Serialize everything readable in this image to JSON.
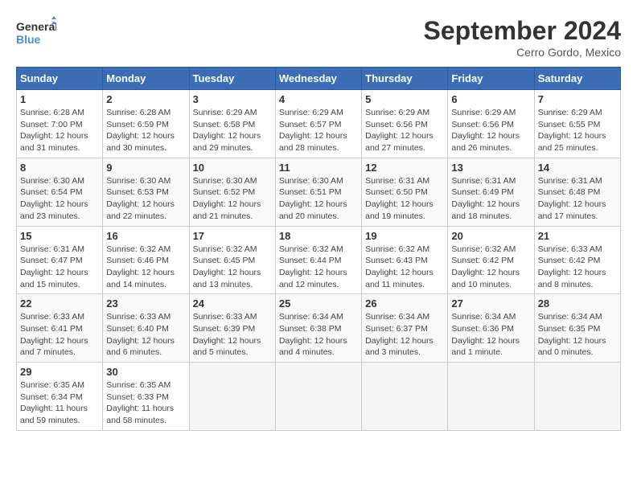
{
  "header": {
    "logo_line1": "General",
    "logo_line2": "Blue",
    "title": "September 2024",
    "subtitle": "Cerro Gordo, Mexico"
  },
  "weekdays": [
    "Sunday",
    "Monday",
    "Tuesday",
    "Wednesday",
    "Thursday",
    "Friday",
    "Saturday"
  ],
  "weeks": [
    [
      {
        "day": "1",
        "sunrise": "6:28 AM",
        "sunset": "7:00 PM",
        "daylight": "12 hours and 31 minutes."
      },
      {
        "day": "2",
        "sunrise": "6:28 AM",
        "sunset": "6:59 PM",
        "daylight": "12 hours and 30 minutes."
      },
      {
        "day": "3",
        "sunrise": "6:29 AM",
        "sunset": "6:58 PM",
        "daylight": "12 hours and 29 minutes."
      },
      {
        "day": "4",
        "sunrise": "6:29 AM",
        "sunset": "6:57 PM",
        "daylight": "12 hours and 28 minutes."
      },
      {
        "day": "5",
        "sunrise": "6:29 AM",
        "sunset": "6:56 PM",
        "daylight": "12 hours and 27 minutes."
      },
      {
        "day": "6",
        "sunrise": "6:29 AM",
        "sunset": "6:56 PM",
        "daylight": "12 hours and 26 minutes."
      },
      {
        "day": "7",
        "sunrise": "6:29 AM",
        "sunset": "6:55 PM",
        "daylight": "12 hours and 25 minutes."
      }
    ],
    [
      {
        "day": "8",
        "sunrise": "6:30 AM",
        "sunset": "6:54 PM",
        "daylight": "12 hours and 23 minutes."
      },
      {
        "day": "9",
        "sunrise": "6:30 AM",
        "sunset": "6:53 PM",
        "daylight": "12 hours and 22 minutes."
      },
      {
        "day": "10",
        "sunrise": "6:30 AM",
        "sunset": "6:52 PM",
        "daylight": "12 hours and 21 minutes."
      },
      {
        "day": "11",
        "sunrise": "6:30 AM",
        "sunset": "6:51 PM",
        "daylight": "12 hours and 20 minutes."
      },
      {
        "day": "12",
        "sunrise": "6:31 AM",
        "sunset": "6:50 PM",
        "daylight": "12 hours and 19 minutes."
      },
      {
        "day": "13",
        "sunrise": "6:31 AM",
        "sunset": "6:49 PM",
        "daylight": "12 hours and 18 minutes."
      },
      {
        "day": "14",
        "sunrise": "6:31 AM",
        "sunset": "6:48 PM",
        "daylight": "12 hours and 17 minutes."
      }
    ],
    [
      {
        "day": "15",
        "sunrise": "6:31 AM",
        "sunset": "6:47 PM",
        "daylight": "12 hours and 15 minutes."
      },
      {
        "day": "16",
        "sunrise": "6:32 AM",
        "sunset": "6:46 PM",
        "daylight": "12 hours and 14 minutes."
      },
      {
        "day": "17",
        "sunrise": "6:32 AM",
        "sunset": "6:45 PM",
        "daylight": "12 hours and 13 minutes."
      },
      {
        "day": "18",
        "sunrise": "6:32 AM",
        "sunset": "6:44 PM",
        "daylight": "12 hours and 12 minutes."
      },
      {
        "day": "19",
        "sunrise": "6:32 AM",
        "sunset": "6:43 PM",
        "daylight": "12 hours and 11 minutes."
      },
      {
        "day": "20",
        "sunrise": "6:32 AM",
        "sunset": "6:42 PM",
        "daylight": "12 hours and 10 minutes."
      },
      {
        "day": "21",
        "sunrise": "6:33 AM",
        "sunset": "6:42 PM",
        "daylight": "12 hours and 8 minutes."
      }
    ],
    [
      {
        "day": "22",
        "sunrise": "6:33 AM",
        "sunset": "6:41 PM",
        "daylight": "12 hours and 7 minutes."
      },
      {
        "day": "23",
        "sunrise": "6:33 AM",
        "sunset": "6:40 PM",
        "daylight": "12 hours and 6 minutes."
      },
      {
        "day": "24",
        "sunrise": "6:33 AM",
        "sunset": "6:39 PM",
        "daylight": "12 hours and 5 minutes."
      },
      {
        "day": "25",
        "sunrise": "6:34 AM",
        "sunset": "6:38 PM",
        "daylight": "12 hours and 4 minutes."
      },
      {
        "day": "26",
        "sunrise": "6:34 AM",
        "sunset": "6:37 PM",
        "daylight": "12 hours and 3 minutes."
      },
      {
        "day": "27",
        "sunrise": "6:34 AM",
        "sunset": "6:36 PM",
        "daylight": "12 hours and 1 minute."
      },
      {
        "day": "28",
        "sunrise": "6:34 AM",
        "sunset": "6:35 PM",
        "daylight": "12 hours and 0 minutes."
      }
    ],
    [
      {
        "day": "29",
        "sunrise": "6:35 AM",
        "sunset": "6:34 PM",
        "daylight": "11 hours and 59 minutes."
      },
      {
        "day": "30",
        "sunrise": "6:35 AM",
        "sunset": "6:33 PM",
        "daylight": "11 hours and 58 minutes."
      },
      null,
      null,
      null,
      null,
      null
    ]
  ]
}
